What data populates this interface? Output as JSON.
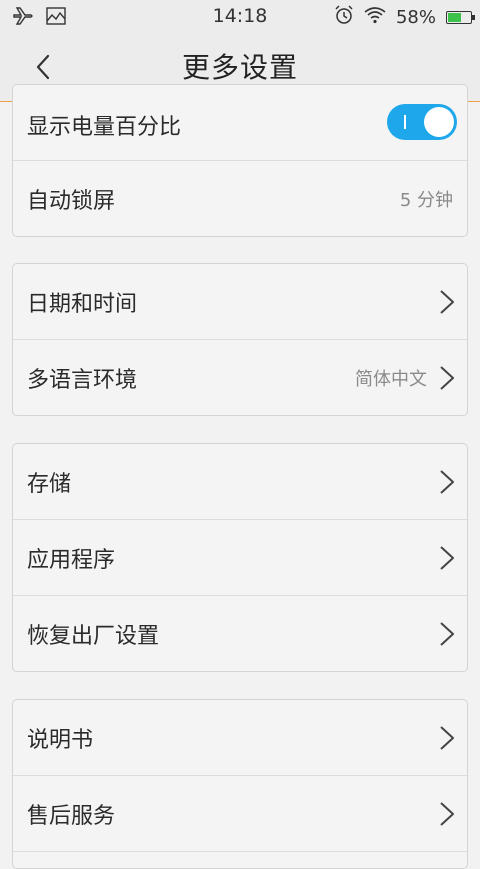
{
  "status_bar": {
    "time": "14:18",
    "battery_percent": "58%",
    "icons": [
      "airplane-icon",
      "image-icon",
      "alarm-icon",
      "wifi-icon",
      "battery-icon"
    ]
  },
  "header": {
    "title": "更多设置",
    "back_icon": "chevron-left-icon"
  },
  "groups": [
    {
      "rows": [
        {
          "label": "显示电量百分比",
          "control": "toggle",
          "on": true
        },
        {
          "label": "自动锁屏",
          "value": "5 分钟"
        }
      ]
    },
    {
      "rows": [
        {
          "label": "日期和时间",
          "chevron": true
        },
        {
          "label": "多语言环境",
          "value": "简体中文",
          "chevron": true
        }
      ]
    },
    {
      "rows": [
        {
          "label": "存储",
          "chevron": true
        },
        {
          "label": "应用程序",
          "chevron": true
        },
        {
          "label": "恢复出厂设置",
          "chevron": true
        }
      ]
    },
    {
      "rows": [
        {
          "label": "说明书",
          "chevron": true
        },
        {
          "label": "售后服务",
          "chevron": true
        }
      ]
    }
  ],
  "colors": {
    "accent": "#1ea7ea",
    "header_divider": "#f0a04b",
    "battery_fill": "#3cc24a"
  }
}
